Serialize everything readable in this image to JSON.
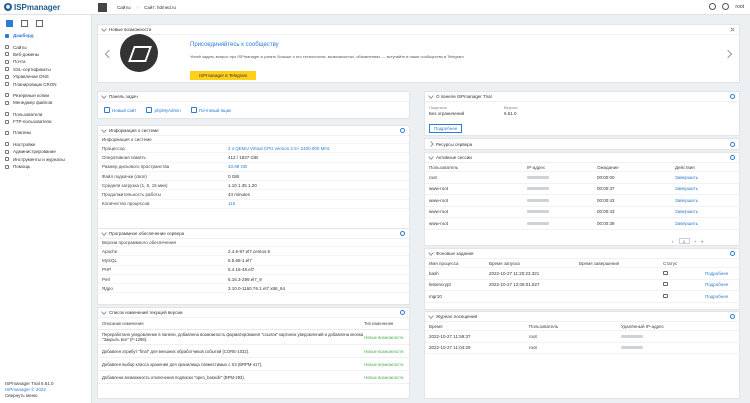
{
  "brand": "ISPmanager",
  "breadcrumb": [
    "Сайты",
    "Сайт: hdmed.ru"
  ],
  "user": "root",
  "sidebar": {
    "active": "Дашборд",
    "items": [
      "Дашборд",
      "Сайты",
      "Веб-домены",
      "Почта",
      "SSL-сертификаты",
      "Управление DNS",
      "Планировщик CRON",
      "Резервные копии",
      "Менеджер файлов",
      "Пользователи",
      "FTP-пользователи",
      "Плагины",
      "Настройки",
      "Администрирование",
      "Инструменты и журналы",
      "Помощь"
    ],
    "footer": [
      "ISPmanager Trial 6.61.0",
      "ISPmanager © 2022",
      "Свернуть меню"
    ]
  },
  "news": {
    "title": "Новые возможности",
    "heading": "Присоединяйтесь к сообществу",
    "body": "Успей задать вопрос про ISPmanager и узнать больше о его технологиях, возможностях, обновлениях — вступайте в наше сообщество в Telegram",
    "button": "ISPmanager в Telegram"
  },
  "quick": {
    "title": "Панель задач",
    "links": [
      "Новый сайт",
      "phpMyAdmin",
      "Почтовый ящик"
    ]
  },
  "sysinfo": {
    "title": "Информация о системе",
    "subtitle": "Информация о системе",
    "rows": [
      [
        "Процессор",
        "2 x QEMU Virtual CPU version 2.5+ 2400.000 MHz"
      ],
      [
        "Оперативная память",
        "412 / 1837 GiB"
      ],
      [
        "Размер дискового пространства",
        "10.98 GB"
      ],
      [
        "Файл подкачки (своп)",
        "0 GiB"
      ],
      [
        "Средняя загрузка (1, 5, 15 мин)",
        "1.10 1.35 1.20"
      ],
      [
        "Продолжительность работы",
        "44 minutes"
      ],
      [
        "Количество процессов",
        "115"
      ]
    ]
  },
  "software": {
    "title": "Программное обеспечение сервера",
    "subtitle": "Версии программного обеспечения",
    "rows": [
      [
        "Apache",
        "2.4.6-97.el7.centos.5"
      ],
      [
        "MySQL",
        "5.5.68-1.el7"
      ],
      [
        "PHP",
        "5.4.16-48.el7"
      ],
      [
        "Perl",
        "5.16.3-299.el7_9"
      ],
      [
        "Ядро",
        "3.10.0-1160.76.1.el7.x86_64"
      ]
    ]
  },
  "changes": {
    "title": "Список изменений текущей версии",
    "col_desc": "Описание изменения",
    "col_type": "Тип изменения",
    "rows": [
      [
        "Переработано уведомление в панели, добавлена возможность форматирования \"ссылок\" картинок уведомлений и добавлена кнопка \"Закрыть все\" (F-1298).",
        "Новые возможности"
      ],
      [
        "Добавлен атрибут \"final\" для внешних обработчиков событий (CORE-1032).",
        "Новые возможности"
      ],
      [
        "Добавлен выбор класса хранения для хранилища совместимых с S3 (BRPM-417).",
        "Новые возможности"
      ],
      [
        "Добавлена возможность отключения подписки \"open_basedir\" (BPM-293).",
        "Новые возможности"
      ]
    ]
  },
  "about": {
    "title": "О панели ISPmanager Trial",
    "lic_label": "Лицензия",
    "ver_label": "Версия",
    "lic": "Без ограничений",
    "ver": "6.61.0",
    "btn": "Подробнее"
  },
  "resources": {
    "title": "Ресурсы сервера"
  },
  "sessions": {
    "title": "Активные сессии",
    "cols": [
      "Пользователь",
      "IP-адрес",
      "Ожидание",
      "Действия"
    ],
    "rows": [
      [
        "root",
        "",
        "00:00:00",
        "Завершить"
      ],
      [
        "www-root",
        "",
        "00:00:37",
        "Завершить"
      ],
      [
        "www-root",
        "",
        "00:00:43",
        "Завершить"
      ],
      [
        "www-root",
        "",
        "00:00:43",
        "Завершить"
      ],
      [
        "www-root",
        "",
        "00:00:39",
        "Завершить"
      ]
    ],
    "page": "1"
  },
  "bg": {
    "title": "Фоновые задания",
    "cols": [
      "Имя процесса",
      "Время запуска",
      "Время завершения",
      "Статус",
      ""
    ],
    "rows": [
      [
        "bash",
        "2022-10-27 11:20:23.321",
        "",
        "",
        "Подробнее"
      ],
      [
        "letsencrypt",
        "2022-10-27 12:08:01.827",
        "",
        "",
        "Подробнее"
      ],
      [
        "mgr10",
        "",
        "",
        "",
        "Подробнее"
      ]
    ]
  },
  "log": {
    "title": "Журнал посещений",
    "cols": [
      "Время",
      "Пользователь",
      "Удалённый IP-адрес"
    ],
    "rows": [
      [
        "2022-10-27 11:59:37",
        "root",
        ""
      ],
      [
        "2022-10-27 11:04:29",
        "root",
        ""
      ]
    ]
  }
}
